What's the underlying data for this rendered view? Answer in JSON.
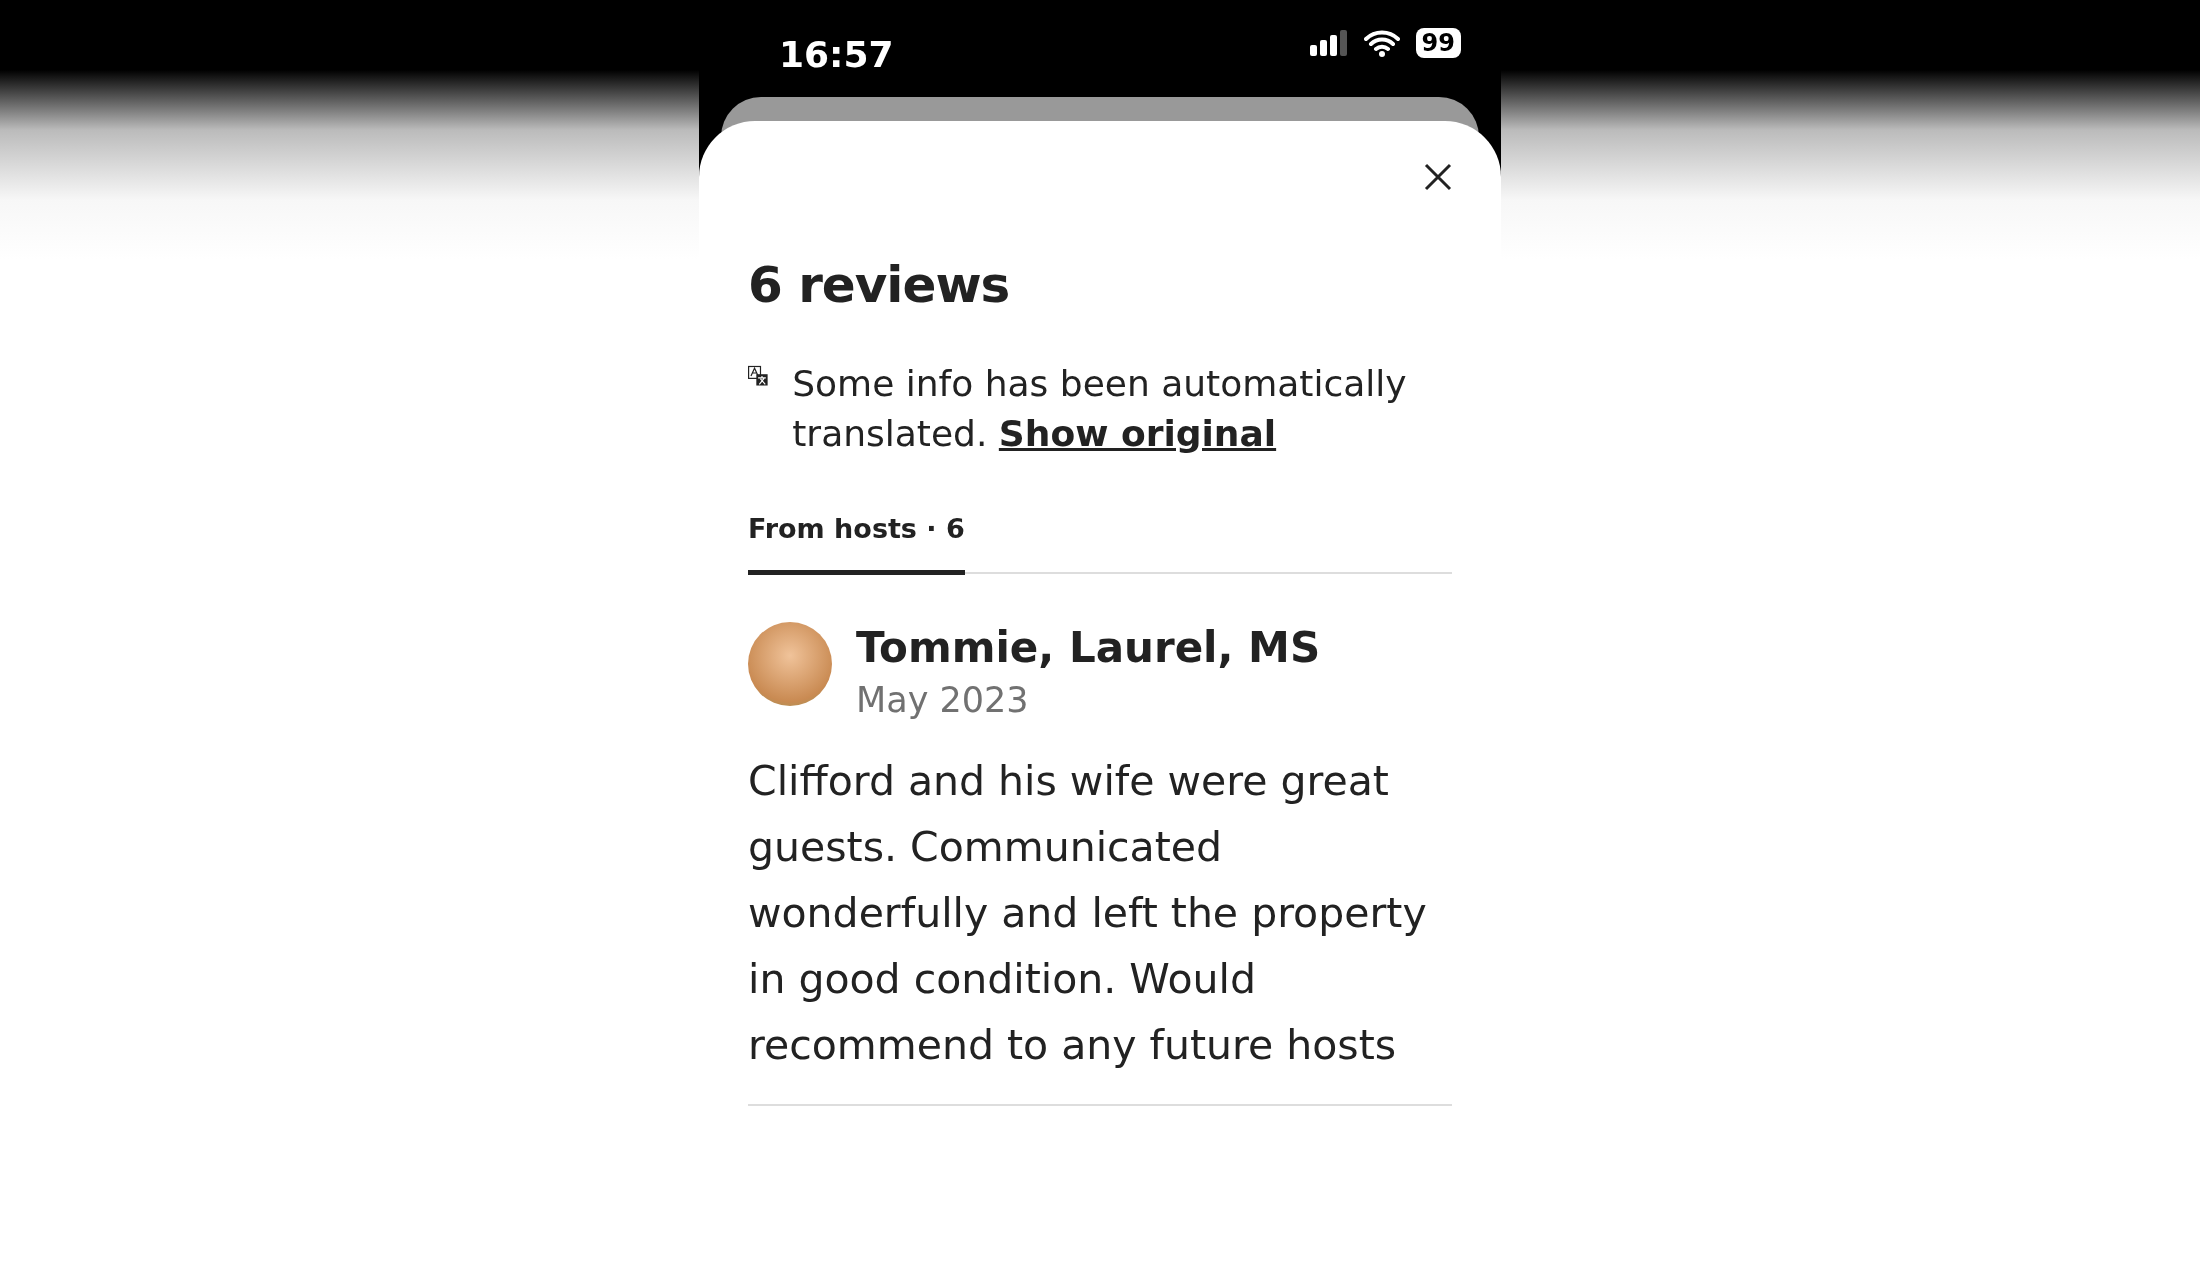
{
  "status_bar": {
    "time": "16:57",
    "battery": "99"
  },
  "sheet": {
    "title": "6 reviews",
    "notice": {
      "text": "Some info has been automatically translated.",
      "link": "Show original"
    },
    "tabs": [
      {
        "label": "From hosts · 6",
        "selected": true
      }
    ],
    "reviews": [
      {
        "name": "Tommie, Laurel, MS",
        "date": "May 2023",
        "text": "Clifford and his wife were great guests. Communicated wonderfully and left the property in good condition. Would recommend to any future hosts"
      }
    ]
  }
}
